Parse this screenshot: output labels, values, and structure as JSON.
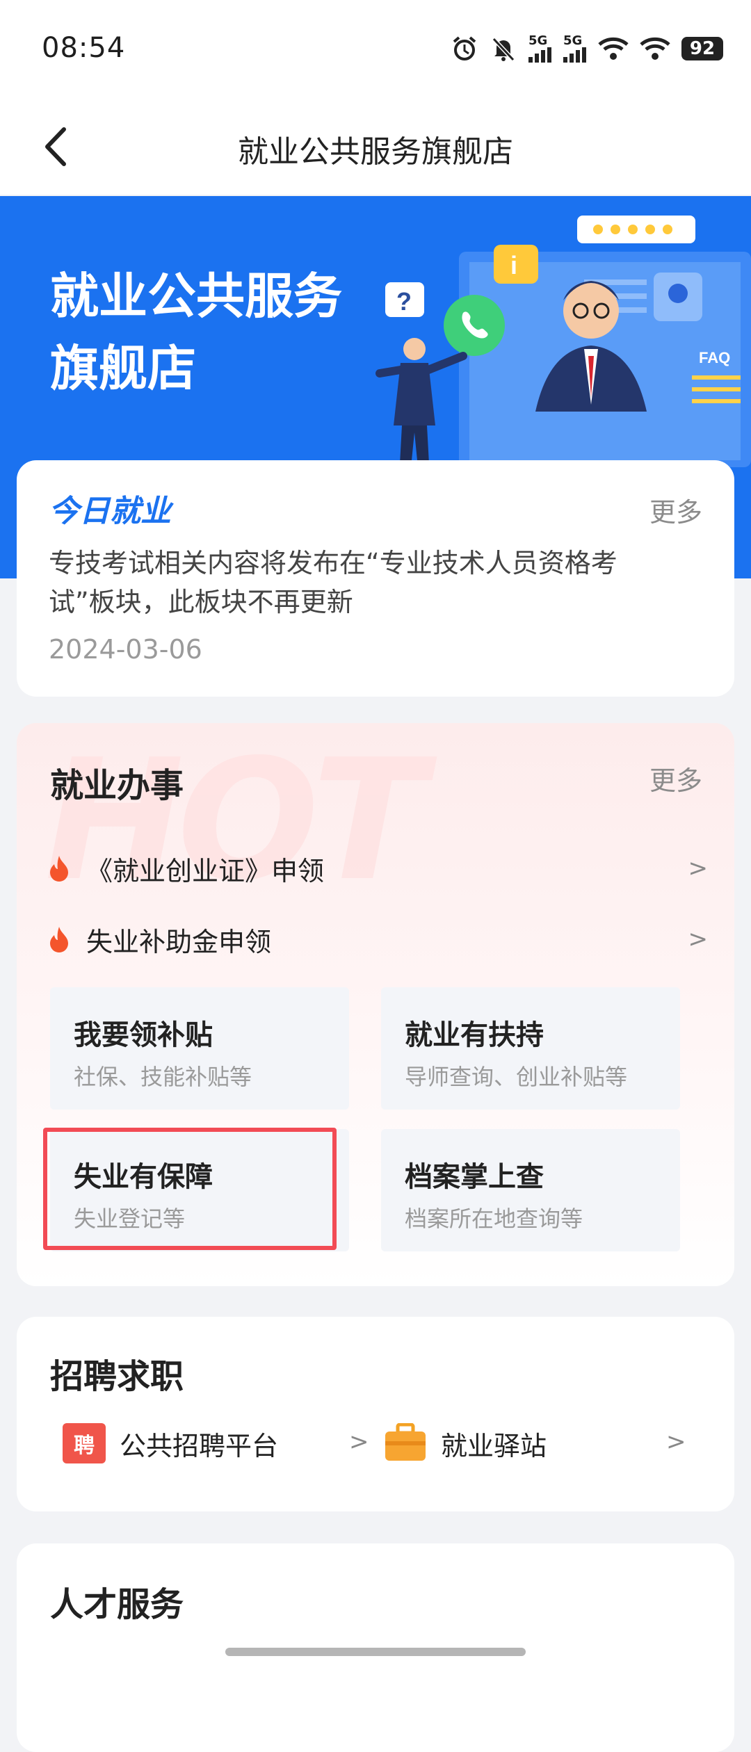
{
  "status_bar": {
    "time": "08:54",
    "battery": "92",
    "signal_label": "5G"
  },
  "nav": {
    "title": "就业公共服务旗舰店"
  },
  "banner": {
    "title_line1": "就业公共服务",
    "title_line2": "旗舰店",
    "faq_label": "FAQ"
  },
  "news": {
    "logo": "今日就业",
    "more": "更多",
    "text": "专技考试相关内容将发布在“专业技术人员资格考试”板块，此板块不再更新",
    "date": "2024-03-06"
  },
  "employment_affairs": {
    "title": "就业办事",
    "more": "更多",
    "watermark": "HOT",
    "hot_items": [
      {
        "label": "《就业创业证》申领"
      },
      {
        "label": "失业补助金申领"
      }
    ],
    "tiles": [
      {
        "title": "我要领补贴",
        "subtitle": "社保、技能补贴等"
      },
      {
        "title": "就业有扶持",
        "subtitle": "导师查询、创业补贴等"
      },
      {
        "title": "失业有保障",
        "subtitle": "失业登记等"
      },
      {
        "title": "档案掌上查",
        "subtitle": "档案所在地查询等"
      }
    ]
  },
  "recruitment": {
    "title": "招聘求职",
    "items": [
      {
        "label": "公共招聘平台",
        "icon_text": "聘"
      },
      {
        "label": "就业驿站"
      }
    ]
  },
  "talent": {
    "title": "人才服务"
  },
  "chevron": ">",
  "colors": {
    "brand_blue": "#1b72f0",
    "highlight_red": "#f24b55"
  }
}
